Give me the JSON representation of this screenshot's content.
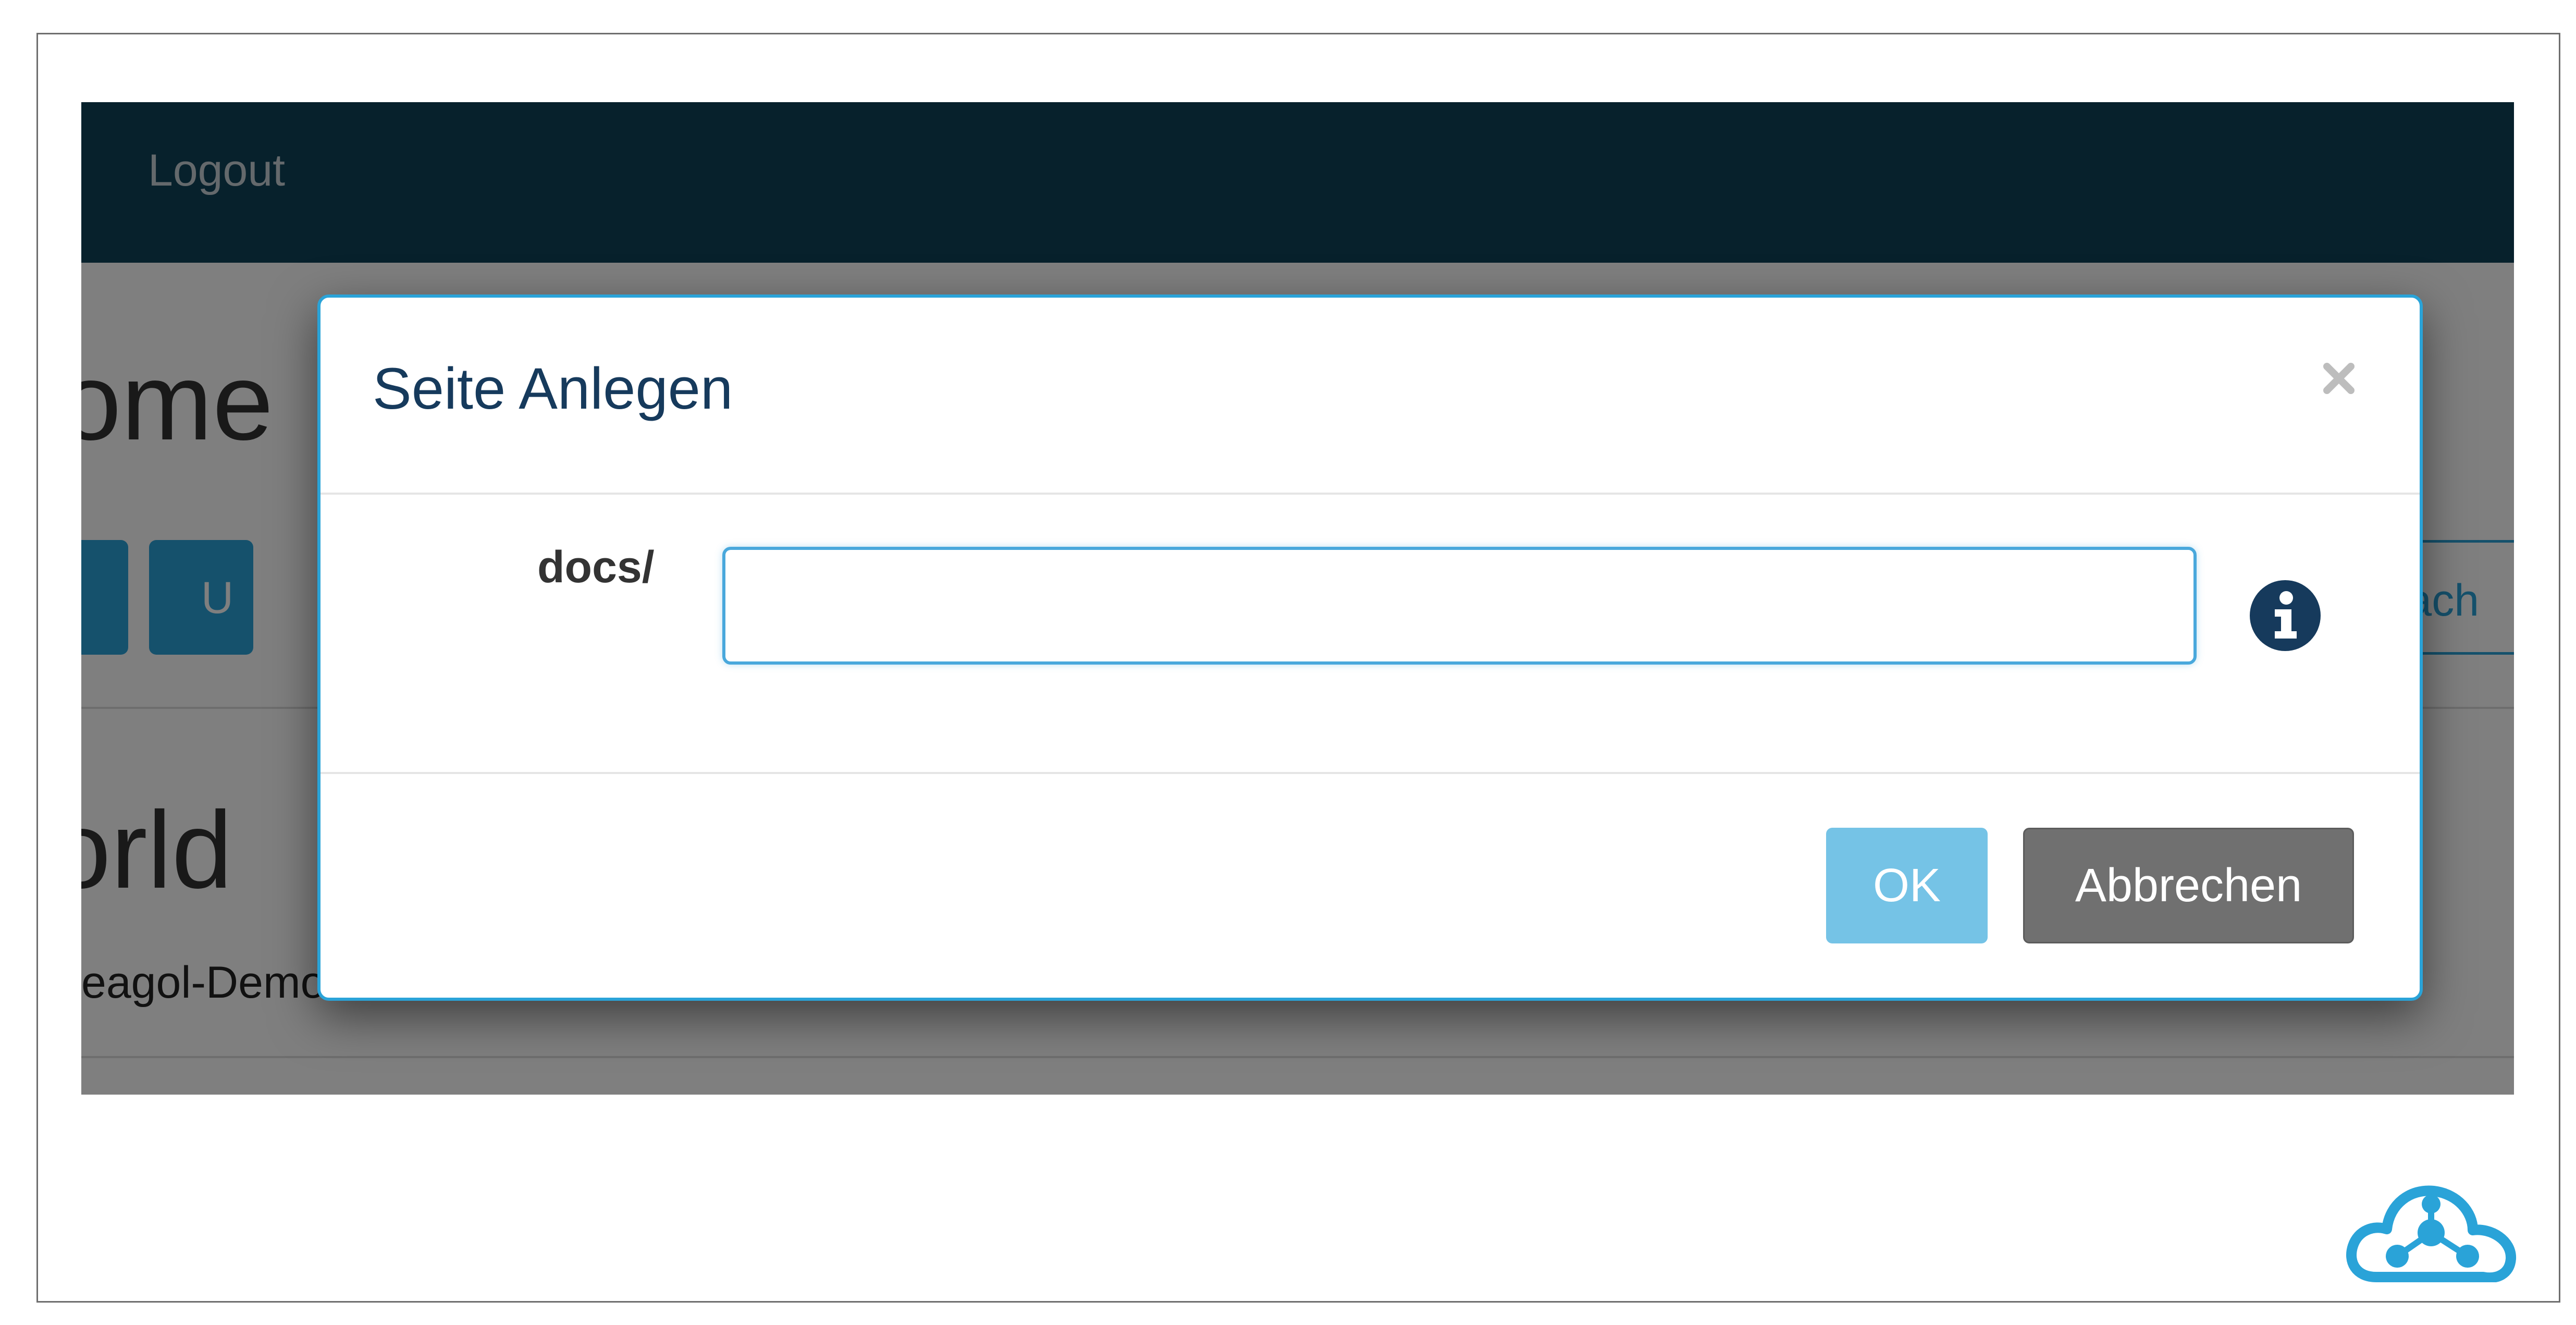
{
  "navbar": {
    "logout_label": "Logout"
  },
  "background": {
    "heading_fragment": "ome",
    "button2_fragment": "U",
    "outline_button_fragment": "en nach",
    "heading2_fragment": "orld",
    "paragraph_fragment": "eagol-Demo! Have some embedded PlantUML:"
  },
  "modal": {
    "title": "Seite Anlegen",
    "close_symbol": "×",
    "field_label": "docs/",
    "input_value": "",
    "ok_label": "OK",
    "cancel_label": "Abbrechen"
  },
  "colors": {
    "navbar": "#0f4358",
    "accent": "#2aa3d8",
    "ok_button": "#75c3e6",
    "cancel_button": "#707070",
    "info_icon": "#163a5c"
  },
  "icons": {
    "info": "info-circle-icon",
    "close": "close-icon",
    "logo": "cloud-network-logo"
  }
}
